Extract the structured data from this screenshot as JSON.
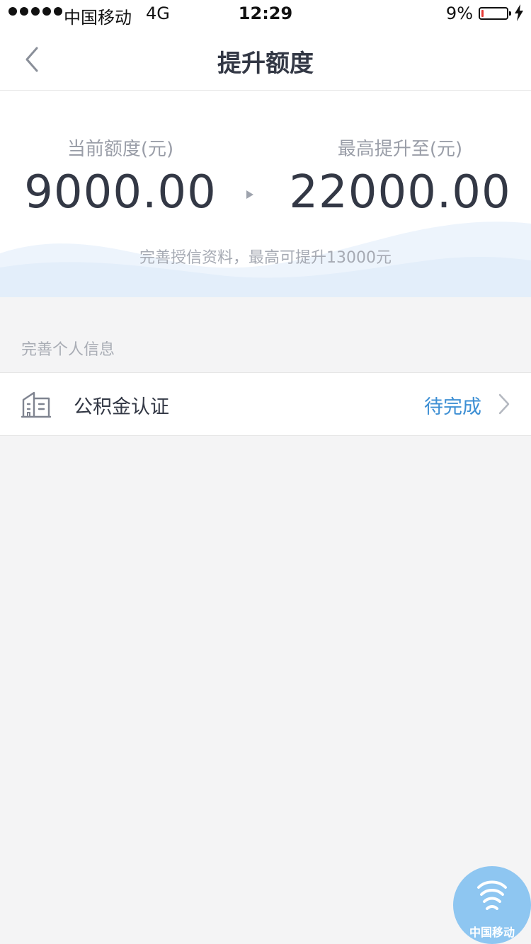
{
  "status_bar": {
    "carrier": "中国移动",
    "network": "4G",
    "time": "12:29",
    "battery_percent": "9%",
    "battery_level": 0.09,
    "charging_icon": "lightning-icon"
  },
  "nav": {
    "title": "提升额度",
    "back_icon": "chevron-left-icon"
  },
  "limits": {
    "current_label": "当前额度(元)",
    "current_value": "9000.00",
    "max_label": "最高提升至(元)",
    "max_value": "22000.00",
    "hint": "完善授信资料，最高可提升13000元"
  },
  "section": {
    "title": "完善个人信息"
  },
  "items": [
    {
      "icon": "building-icon",
      "label": "公积金认证",
      "status": "待完成"
    }
  ],
  "floating_badge": {
    "icon": "china-mobile-logo-icon",
    "label": "中国移动"
  },
  "colors": {
    "status_pending": "#3d8fd4",
    "text_primary": "#333845",
    "text_secondary": "#a6aab3",
    "page_background": "#f4f4f5",
    "fab_background": "#8ec6f1"
  }
}
